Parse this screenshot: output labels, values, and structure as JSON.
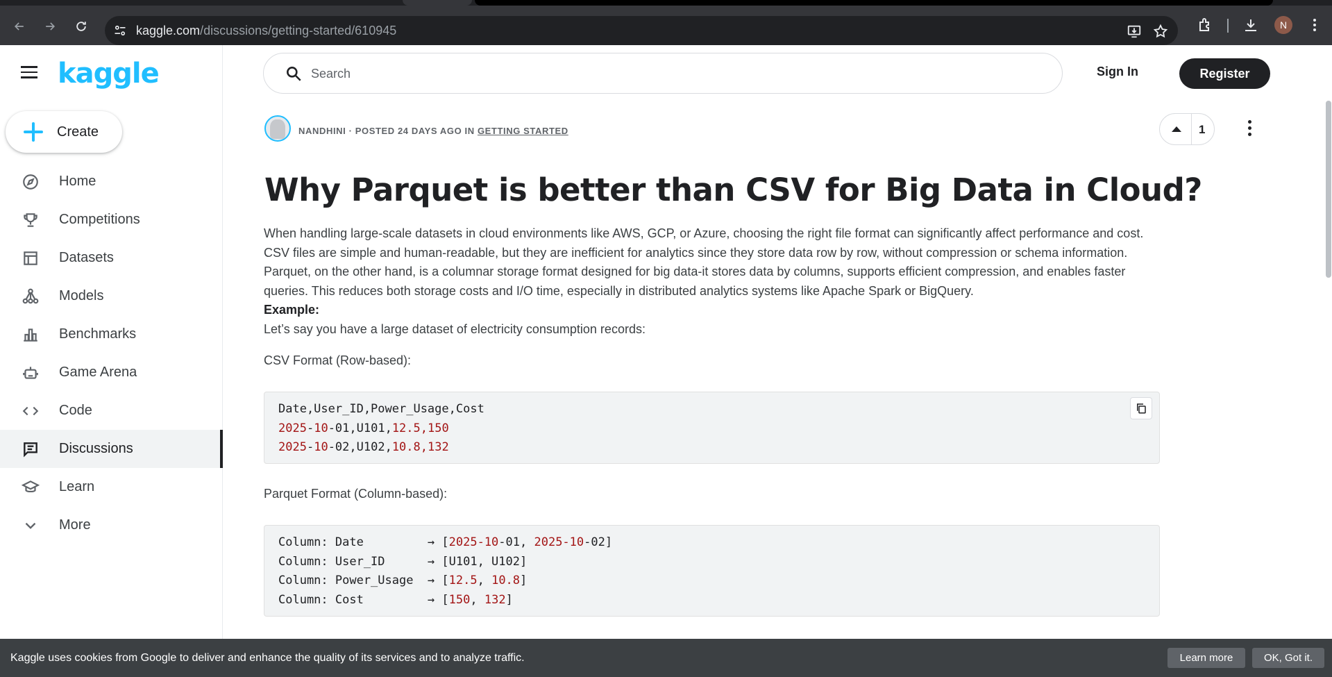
{
  "browser": {
    "url_domain": "kaggle.com",
    "url_path": "/discussions/getting-started/610945",
    "profile_initial": "N"
  },
  "sidebar": {
    "logo": "kaggle",
    "create_label": "Create",
    "items": [
      {
        "label": "Home",
        "icon": "compass-icon"
      },
      {
        "label": "Competitions",
        "icon": "trophy-icon"
      },
      {
        "label": "Datasets",
        "icon": "table-icon"
      },
      {
        "label": "Models",
        "icon": "models-icon"
      },
      {
        "label": "Benchmarks",
        "icon": "bar-chart-icon"
      },
      {
        "label": "Game Arena",
        "icon": "robot-icon"
      },
      {
        "label": "Code",
        "icon": "code-icon"
      },
      {
        "label": "Discussions",
        "icon": "chat-icon",
        "active": true
      },
      {
        "label": "Learn",
        "icon": "school-icon"
      },
      {
        "label": "More",
        "icon": "chevron-down-icon"
      }
    ]
  },
  "header": {
    "search_placeholder": "Search",
    "signin_label": "Sign In",
    "register_label": "Register"
  },
  "post": {
    "author": "NANDHINI",
    "meta_middle": " · POSTED 24 DAYS AGO IN ",
    "category": "GETTING STARTED",
    "votes": "1",
    "title": "Why Parquet is better than CSV for Big Data in Cloud?",
    "body": "When handling large-scale datasets in cloud environments like AWS, GCP, or Azure, choosing the right file format can significantly affect performance and cost. CSV files are simple and human-readable, but they are inefficient for analytics since they store data row by row, without compression or schema information. Parquet, on the other hand, is a columnar storage format designed for big data-it stores data by columns, supports efficient compression, and enables faster queries. This reduces both storage costs and I/O time, especially in distributed analytics systems like Apache Spark or BigQuery.",
    "example_label": "Example:",
    "example_intro": "Let’s say you have a large dataset of electricity consumption records:",
    "csv_heading": "CSV Format (Row-based):",
    "csv_code": {
      "header": "Date,User_ID,Power_Usage,Cost",
      "rows": [
        {
          "d1": "2025",
          "d2": "-",
          "d3": "10",
          "d4": "-01,U101,",
          "v1": "12.5",
          "c": ",",
          "v2": "150"
        },
        {
          "d1": "2025",
          "d2": "-",
          "d3": "10",
          "d4": "-02,U102,",
          "v1": "10.8",
          "c": ",",
          "v2": "132"
        }
      ]
    },
    "parquet_heading": "Parquet Format (Column-based):",
    "parquet_code": [
      {
        "label": "Column: Date         → [",
        "parts": [
          "2025-10",
          "-01, ",
          "2025-10",
          "-02]"
        ]
      },
      {
        "label": "Column: User_ID      → [U101, U102]"
      },
      {
        "label": "Column: Power_Usage  → [",
        "parts": [
          "12.5",
          ", ",
          "10.8",
          "]"
        ]
      },
      {
        "label": "Column: Cost         → [",
        "parts": [
          "150",
          ", ",
          "132",
          "]"
        ]
      }
    ]
  },
  "cookie": {
    "message": "Kaggle uses cookies from Google to deliver and enhance the quality of its services and to analyze traffic.",
    "learn_more": "Learn more",
    "ok": "OK, Got it."
  }
}
